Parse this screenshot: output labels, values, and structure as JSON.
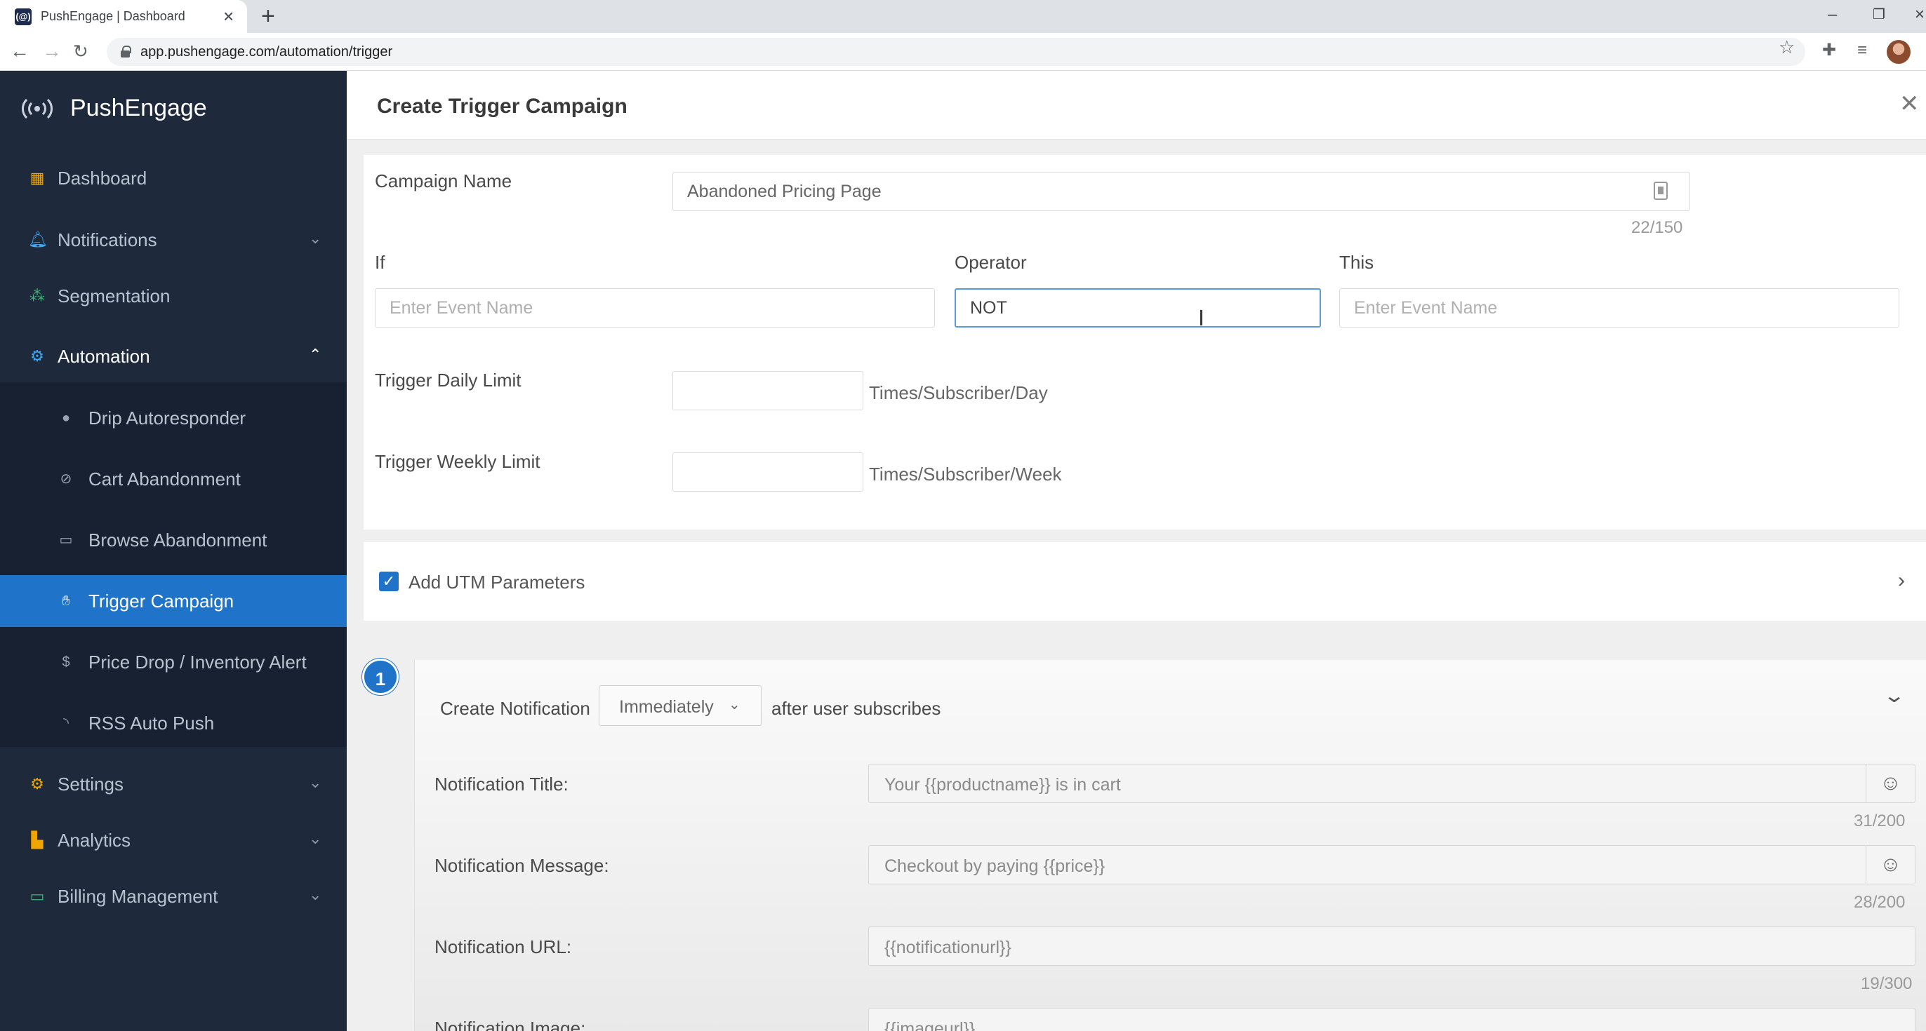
{
  "browser": {
    "tab_title": "PushEngage | Dashboard",
    "favicon_text": "(@)",
    "url": "app.pushengage.com/automation/trigger"
  },
  "sidebar": {
    "brand": "PushEngage",
    "items": [
      {
        "label": "Dashboard",
        "icon": "dashboard-grid-icon"
      },
      {
        "label": "Notifications",
        "icon": "bell-icon"
      },
      {
        "label": "Segmentation",
        "icon": "segment-icon"
      },
      {
        "label": "Automation",
        "icon": "automation-icon"
      },
      {
        "label": "Settings",
        "icon": "gear-icon"
      },
      {
        "label": "Analytics",
        "icon": "bar-chart-icon"
      },
      {
        "label": "Billing Management",
        "icon": "credit-card-icon"
      }
    ],
    "automation_sub": [
      {
        "label": "Drip Autoresponder",
        "icon": "drop-icon"
      },
      {
        "label": "Cart Abandonment",
        "icon": "cart-off-icon"
      },
      {
        "label": "Browse Abandonment",
        "icon": "browse-off-icon"
      },
      {
        "label": "Trigger Campaign",
        "icon": "trigger-icon"
      },
      {
        "label": "Price Drop / Inventory Alert",
        "icon": "dollar-icon"
      },
      {
        "label": "RSS Auto Push",
        "icon": "rss-icon"
      }
    ],
    "active_item": "Trigger Campaign",
    "accent": "#1f73c9"
  },
  "header": {
    "title": "Create Trigger Campaign"
  },
  "form": {
    "campaign_name_label": "Campaign Name",
    "campaign_name_value": "Abandoned Pricing Page",
    "campaign_name_counter": "22/150",
    "if_label": "If",
    "if_placeholder": "Enter Event Name",
    "operator_label": "Operator",
    "operator_value": "NOT",
    "this_label": "This",
    "this_placeholder": "Enter Event Name",
    "daily_limit_label": "Trigger Daily Limit",
    "daily_limit_value": "",
    "daily_limit_unit": "Times/Subscriber/Day",
    "weekly_limit_label": "Trigger Weekly Limit",
    "weekly_limit_value": "",
    "weekly_limit_unit": "Times/Subscriber/Week"
  },
  "utm": {
    "label": "Add UTM Parameters",
    "checked": true
  },
  "notification": {
    "step": "1",
    "create_label": "Create Notification",
    "timing": "Immediately",
    "after_label": "after user subscribes",
    "title_label": "Notification Title:",
    "title_value": "Your {{productname}} is in cart",
    "title_counter": "31/200",
    "message_label": "Notification Message:",
    "message_value": "Checkout by paying {{price}}",
    "message_counter": "28/200",
    "url_label": "Notification URL:",
    "url_value": "{{notificationurl}}",
    "url_counter": "19/300",
    "image_label": "Notification Image:",
    "image_value": "{{imageurl}}"
  }
}
